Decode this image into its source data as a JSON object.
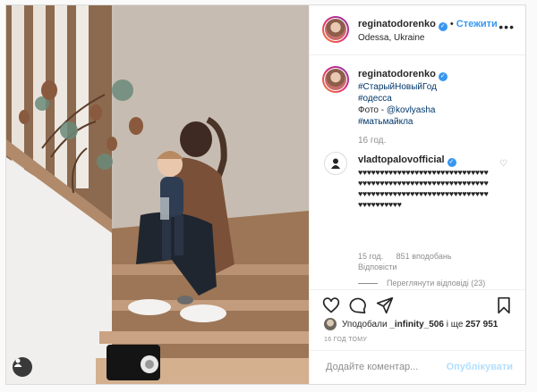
{
  "author": {
    "username": "reginatodorenko",
    "follow_label": "Стежити",
    "location": "Odessa, Ukraine"
  },
  "caption": {
    "username": "reginatodorenko",
    "hashtag_1": "#СтарыйНовыйГод",
    "hashtag_2": "#одесса",
    "photo_credit_prefix": "Фото - ",
    "photo_credit_handle": "@kovlyasha",
    "hashtag_3": "#матьмайкла",
    "time": "16 год."
  },
  "comment": {
    "username": "vladtopalovofficial",
    "hearts": "♥♥♥♥♥♥♥♥♥♥♥♥♥♥♥♥♥♥♥♥♥♥♥♥♥♥♥♥♥♥♥♥♥♥♥♥♥♥♥♥♥♥♥♥♥♥♥♥♥♥♥♥♥♥♥♥♥♥♥♥♥♥♥♥♥♥♥♥♥♥♥♥♥♥♥♥♥♥♥♥♥♥♥♥♥♥♥♥♥♥♥♥♥♥♥♥♥♥♥♥",
    "time": "15 год.",
    "likes": "851 вподобань",
    "reply_label": "Відповісти",
    "hide_replies": "Переглянути відповіді (23)"
  },
  "engagement": {
    "liked_by_prefix": "Уподобали",
    "liked_by_user": "_infinity_506",
    "liked_by_suffix": "і ще",
    "likes_count": "257 951",
    "post_time": "16 ГОД ТОМУ"
  },
  "add_comment": {
    "placeholder": "Додайте коментар...",
    "publish_label": "Опублікувати"
  },
  "icons": {
    "verified": "verified-badge-icon",
    "like": "heart-icon",
    "comment": "comment-bubble-icon",
    "share": "paper-plane-icon",
    "save": "bookmark-icon",
    "more": "more-options-icon",
    "tagged_user": "user-tag-icon"
  },
  "colors": {
    "accent": "#3897f0",
    "text": "#262626",
    "muted": "#8e8e8e",
    "publish_disabled": "#b2dffc"
  }
}
